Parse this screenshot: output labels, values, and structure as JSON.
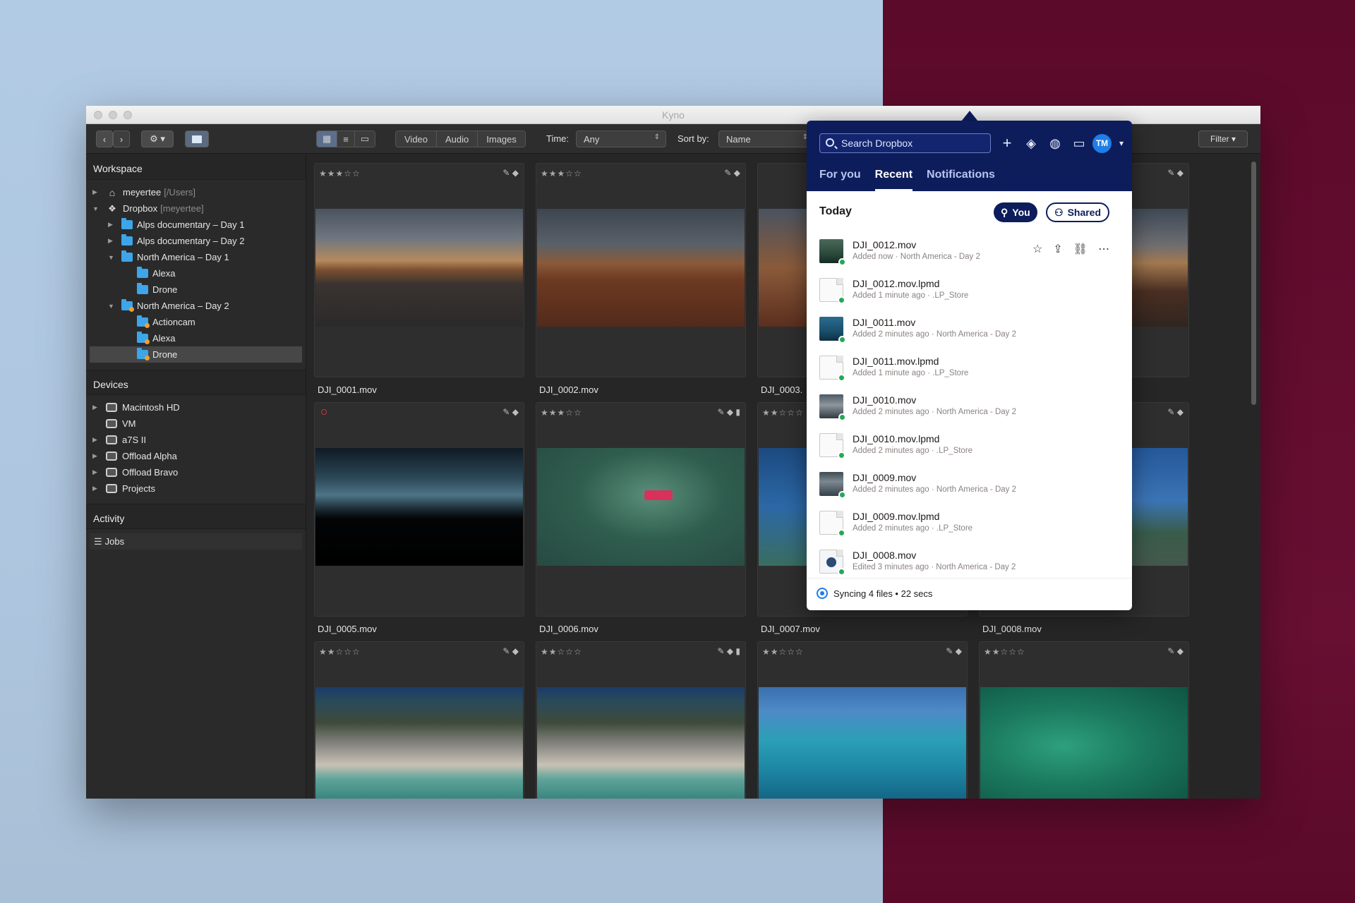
{
  "window": {
    "title": "Kyno"
  },
  "toolbar": {
    "views": [
      "Video",
      "Audio",
      "Images"
    ],
    "time_label": "Time:",
    "time_value": "Any",
    "sort_label": "Sort by:",
    "sort_value": "Name",
    "filter_label": "Filter"
  },
  "sidebar": {
    "workspace_label": "Workspace",
    "workspace": [
      {
        "label": "meyertee",
        "suffix": "[/Users]"
      },
      {
        "label": "Dropbox",
        "suffix": "[meyertee]"
      },
      {
        "label": "Alps documentary – Day 1"
      },
      {
        "label": "Alps documentary – Day 2"
      },
      {
        "label": "North America – Day 1"
      },
      {
        "label": "Alexa"
      },
      {
        "label": "Drone"
      },
      {
        "label": "North America – Day 2"
      },
      {
        "label": "Actioncam"
      },
      {
        "label": "Alexa"
      },
      {
        "label": "Drone"
      }
    ],
    "devices_label": "Devices",
    "devices": [
      "Macintosh HD",
      "VM",
      "a7S II",
      "Offload Alpha",
      "Offload Bravo",
      "Projects"
    ],
    "activity_label": "Activity",
    "jobs_label": "Jobs"
  },
  "grid": {
    "files": [
      "DJI_0001.mov",
      "DJI_0002.mov",
      "DJI_0003.",
      "DJI_0005.mov",
      "DJI_0006.mov",
      "DJI_0007.mov",
      "DJI_0008.mov"
    ],
    "stars": {
      "three": "★★★☆☆",
      "two": "★★☆☆☆"
    }
  },
  "dropbox": {
    "search_placeholder": "Search Dropbox",
    "avatar": "TM",
    "tabs": [
      "For you",
      "Recent",
      "Notifications"
    ],
    "section": "Today",
    "filter_you": "You",
    "filter_shared": "Shared",
    "files": [
      {
        "name": "DJI_0012.mov",
        "meta": "Added now · North America - Day 2",
        "kind": "video"
      },
      {
        "name": "DJI_0012.mov.lpmd",
        "meta": "Added 1 minute ago · .LP_Store",
        "kind": "doc"
      },
      {
        "name": "DJI_0011.mov",
        "meta": "Added 2 minutes ago · North America - Day 2",
        "kind": "video"
      },
      {
        "name": "DJI_0011.mov.lpmd",
        "meta": "Added 1 minute ago · .LP_Store",
        "kind": "doc"
      },
      {
        "name": "DJI_0010.mov",
        "meta": "Added 2 minutes ago · North America - Day 2",
        "kind": "video"
      },
      {
        "name": "DJI_0010.mov.lpmd",
        "meta": "Added 2 minutes ago · .LP_Store",
        "kind": "doc"
      },
      {
        "name": "DJI_0009.mov",
        "meta": "Added 2 minutes ago · North America - Day 2",
        "kind": "video"
      },
      {
        "name": "DJI_0009.mov.lpmd",
        "meta": "Added 2 minutes ago · .LP_Store",
        "kind": "doc"
      },
      {
        "name": "DJI_0008.mov",
        "meta": "Edited 3 minutes ago · North America - Day 2",
        "kind": "video"
      }
    ],
    "sync_status": "Syncing 4 files • 22 secs"
  }
}
